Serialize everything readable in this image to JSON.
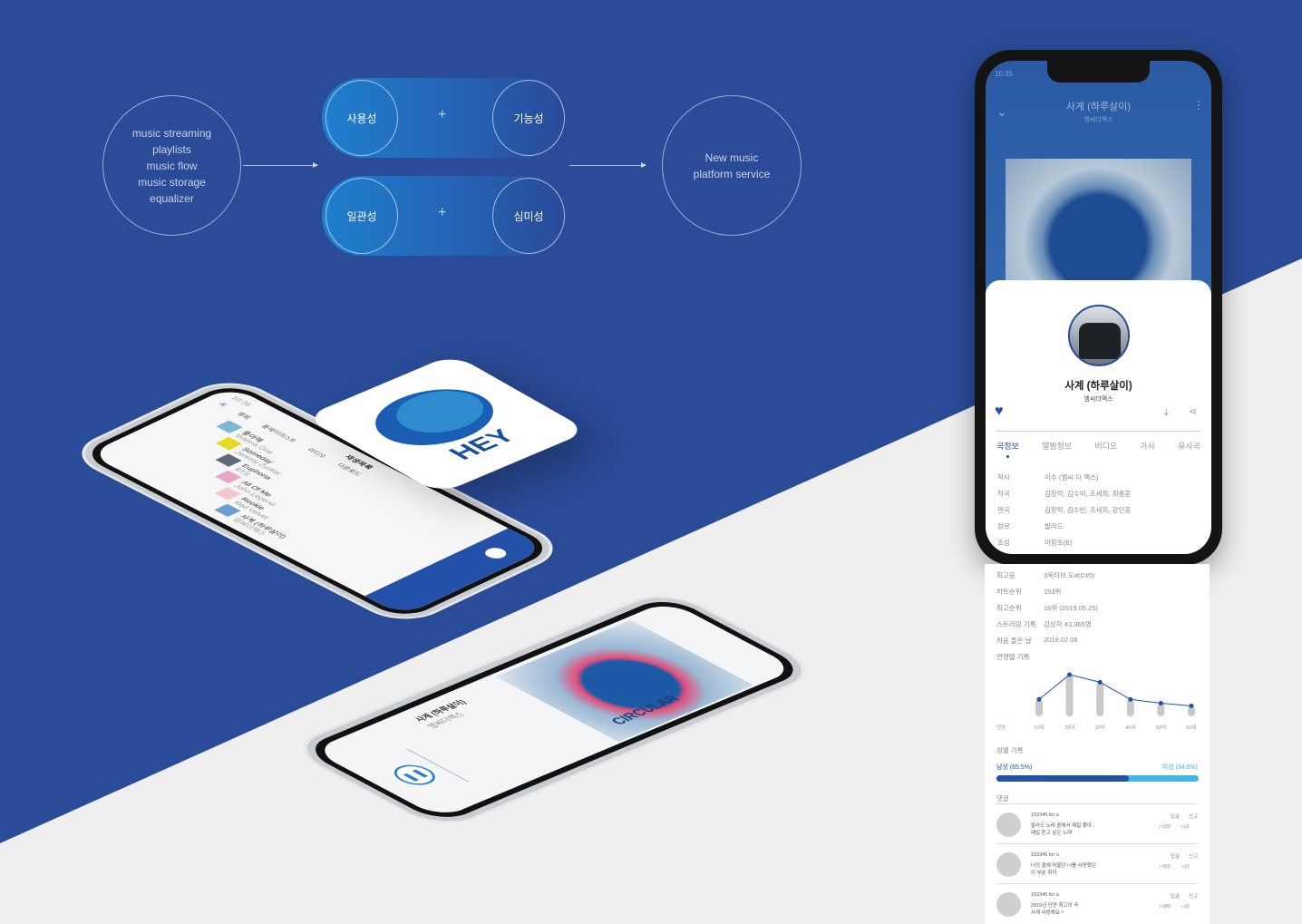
{
  "concept": {
    "features": [
      "music streaming",
      "playlists",
      "music flow",
      "music storage",
      "equalizer"
    ],
    "values_top": [
      "사용성",
      "기능성"
    ],
    "values_bottom": [
      "일관성",
      "심미성"
    ],
    "plus": "+",
    "result": [
      "New music",
      "platform service"
    ]
  },
  "logo": {
    "text": "HEY",
    "colors": [
      "#1a5fb4",
      "#3aa0dc"
    ]
  },
  "list_phone": {
    "time": "10:35",
    "header": "재생목록",
    "tabs": [
      "곡",
      "앨범",
      "플레이리스트",
      "라디오",
      "다운로드"
    ],
    "songs": [
      {
        "title": "좋아해",
        "artist": "Wanna One"
      },
      {
        "title": "Someday",
        "artist": "Jeremy Zucker"
      },
      {
        "title": "Euphoria",
        "artist": "BTS"
      },
      {
        "title": "All Of Me",
        "artist": "John Legend"
      },
      {
        "title": "Rookie",
        "artist": "Red Velvet"
      },
      {
        "title": "사계 (하루살이)",
        "artist": "엠씨더맥스"
      }
    ]
  },
  "player_phone": {
    "title": "사계 (하루살이)",
    "artist": "엠씨더맥스",
    "album_art_text": "CIRCULAR"
  },
  "detail": {
    "status_time": "10:35",
    "title": "사계 (하루살이)",
    "artist": "엠씨더맥스",
    "tabs": [
      "곡정보",
      "앨범정보",
      "비디오",
      "가사",
      "유사곡"
    ],
    "active_tab": "곡정보",
    "info": [
      {
        "k": "작사",
        "v": "이수 (엠씨 더 맥스)"
      },
      {
        "k": "작곡",
        "v": "김창락, 김수빅, 조세희, 최충훈"
      },
      {
        "k": "편곡",
        "v": "김창락, 김수빈, 조세희, 강민훈"
      },
      {
        "k": "장르",
        "v": "발라드"
      },
      {
        "k": "조성",
        "v": "마장조(E)"
      },
      {
        "k": "최고음",
        "v": "3옥타브 도#(C#5)"
      },
      {
        "k": "차트순위",
        "v": "153위"
      },
      {
        "k": "최고순위",
        "v": "16위 (2019.05.25)"
      },
      {
        "k": "스트리밍 기록",
        "v": "감상자 43,365명"
      },
      {
        "k": "처음 들은 날",
        "v": "2019.02.08"
      }
    ],
    "age_title": "연령별 기록",
    "gender_title": "성별 기록",
    "male": "남성 (65.5%)",
    "female": "여성 (34.5%)",
    "male_pct": 65.5,
    "comments_title": "댓글",
    "comments": [
      {
        "user": "102345 for u",
        "text1": "발라드 노래 중에서 제일 좋아..",
        "text2": "매일 듣고 싶은 노래",
        "reply": "답글",
        "report": "신고",
        "likes": "30",
        "dislikes": "2"
      },
      {
        "user": "102345 for u",
        "text1": "너의 곁에 머물던 너를 사랑했던",
        "text2": "이 부분 취저",
        "reply": "답글",
        "report": "신고",
        "likes": "53",
        "dislikes": "1"
      },
      {
        "user": "102345 for u",
        "text1": "2019년 단연 최고의 곡",
        "text2": "사계 사랑해요~!",
        "reply": "답글",
        "report": "신고",
        "likes": "80",
        "dislikes": "0"
      }
    ],
    "accent": "#2350a8",
    "accent_light": "#3fb6e8"
  },
  "chart_data": {
    "type": "line",
    "title": "연령별 기록",
    "xlabel": "연령",
    "categories": [
      "10대",
      "20대",
      "30대",
      "40대",
      "50대",
      "60대"
    ],
    "values": [
      35,
      100,
      80,
      35,
      25,
      18
    ]
  }
}
